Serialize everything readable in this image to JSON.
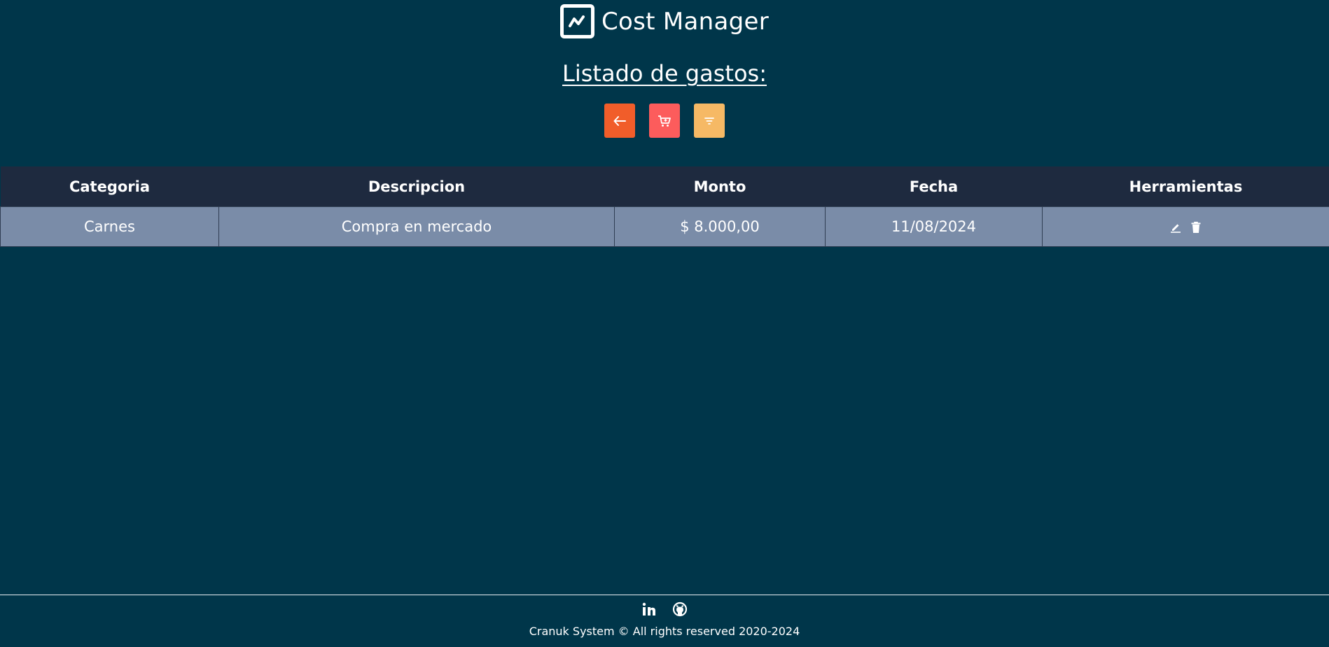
{
  "header": {
    "title": "Cost Manager",
    "logo_icon": "trend-line-icon"
  },
  "page": {
    "heading": "Listado de gastos:"
  },
  "toolbar": {
    "buttons": [
      {
        "icon": "arrow-left-icon",
        "color": "#f15d2a"
      },
      {
        "icon": "cart-add-icon",
        "color": "#fc5c5c"
      },
      {
        "icon": "filter-icon",
        "color": "#f6b965"
      }
    ]
  },
  "table": {
    "columns": [
      "Categoria",
      "Descripcion",
      "Monto",
      "Fecha",
      "Herramientas"
    ],
    "rows": [
      {
        "categoria": "Carnes",
        "descripcion": "Compra en mercado",
        "monto": "$ 8.000,00",
        "fecha": "11/08/2024",
        "tools": [
          "edit-icon",
          "trash-icon"
        ]
      }
    ]
  },
  "footer": {
    "social": [
      "linkedin-icon",
      "github-icon"
    ],
    "copyright": "Cranuk System © All rights reserved 2020-2024"
  },
  "colors": {
    "background": "#00364a",
    "table_header": "#1e2a3f",
    "table_row": "#7a8ca8"
  }
}
